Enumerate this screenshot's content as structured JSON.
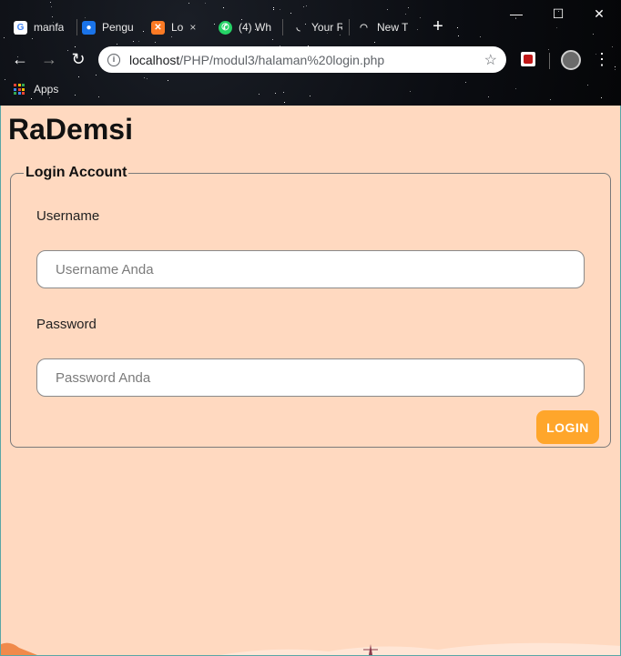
{
  "browser": {
    "tabs": [
      {
        "label": "manfa",
        "icon": "google-icon",
        "color": "#ffffff"
      },
      {
        "label": "Pengu",
        "icon": "contact-icon",
        "color": "#1a73e8"
      },
      {
        "label": "Lo",
        "icon": "xampp-icon",
        "color": "#fb7a24"
      },
      {
        "label": "(4) Wh",
        "icon": "whatsapp-icon",
        "color": "#25d366"
      },
      {
        "label": "Your R",
        "icon": "loading-icon",
        "color": "#dddddd"
      },
      {
        "label": "New T",
        "icon": "loading-icon",
        "color": "#dddddd"
      }
    ],
    "active_tab_close": "×",
    "new_tab": "+",
    "window_controls": {
      "minimize": "—",
      "maximize": "☐",
      "close": "✕"
    },
    "url_host": "localhost",
    "url_path": "/PHP/modul3/halaman%20login.php",
    "bookmarks": {
      "apps_label": "Apps"
    }
  },
  "page": {
    "brand": "RaDemsi",
    "form": {
      "legend": "Login Account",
      "username_label": "Username",
      "username_placeholder": "Username Anda",
      "password_label": "Password",
      "password_placeholder": "Password Anda",
      "login_button": "LOGIN"
    },
    "colors": {
      "background": "#ffd9c0",
      "accent": "#ffa62b"
    }
  }
}
